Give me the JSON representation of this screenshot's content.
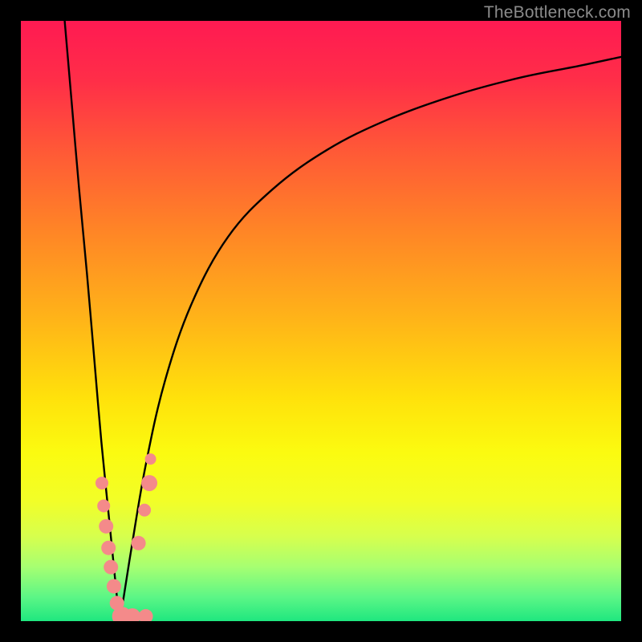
{
  "watermark": "TheBottleneck.com",
  "gradient_stops": [
    {
      "offset": 0.0,
      "color": "#ff1a52"
    },
    {
      "offset": 0.1,
      "color": "#ff2e48"
    },
    {
      "offset": 0.22,
      "color": "#ff5a36"
    },
    {
      "offset": 0.35,
      "color": "#ff8526"
    },
    {
      "offset": 0.5,
      "color": "#ffb518"
    },
    {
      "offset": 0.63,
      "color": "#ffe20b"
    },
    {
      "offset": 0.72,
      "color": "#fbfb10"
    },
    {
      "offset": 0.8,
      "color": "#f2fe28"
    },
    {
      "offset": 0.86,
      "color": "#d6ff4e"
    },
    {
      "offset": 0.91,
      "color": "#a6ff72"
    },
    {
      "offset": 0.96,
      "color": "#5cf686"
    },
    {
      "offset": 1.0,
      "color": "#1fe77f"
    }
  ],
  "chart_data": {
    "type": "line",
    "title": "",
    "xlabel": "",
    "ylabel": "",
    "xlim": [
      0,
      1
    ],
    "ylim": [
      0,
      1
    ],
    "note": "x and y are normalized to [0,1]; y is drawn from top (0) to bottom (1). The minimum of both curves occurs near x≈0.165, y≈1.0.",
    "series": [
      {
        "name": "left-curve",
        "x": [
          0.073,
          0.085,
          0.097,
          0.11,
          0.122,
          0.134,
          0.147,
          0.159,
          0.165
        ],
        "y": [
          0.0,
          0.14,
          0.28,
          0.42,
          0.56,
          0.7,
          0.83,
          0.95,
          1.0
        ]
      },
      {
        "name": "right-curve",
        "x": [
          0.165,
          0.184,
          0.208,
          0.24,
          0.285,
          0.345,
          0.42,
          0.51,
          0.61,
          0.72,
          0.83,
          0.93,
          1.0
        ],
        "y": [
          1.0,
          0.88,
          0.74,
          0.6,
          0.47,
          0.36,
          0.28,
          0.215,
          0.165,
          0.125,
          0.095,
          0.075,
          0.06
        ]
      }
    ],
    "markers": {
      "name": "pink-markers",
      "color": "#f48a8a",
      "points": [
        {
          "x": 0.135,
          "y": 0.77,
          "r": 8
        },
        {
          "x": 0.138,
          "y": 0.808,
          "r": 8
        },
        {
          "x": 0.142,
          "y": 0.842,
          "r": 9
        },
        {
          "x": 0.146,
          "y": 0.878,
          "r": 9
        },
        {
          "x": 0.15,
          "y": 0.91,
          "r": 9
        },
        {
          "x": 0.155,
          "y": 0.942,
          "r": 9
        },
        {
          "x": 0.16,
          "y": 0.97,
          "r": 9
        },
        {
          "x": 0.168,
          "y": 0.992,
          "r": 12
        },
        {
          "x": 0.186,
          "y": 0.992,
          "r": 10
        },
        {
          "x": 0.208,
          "y": 0.992,
          "r": 9
        },
        {
          "x": 0.196,
          "y": 0.87,
          "r": 9
        },
        {
          "x": 0.206,
          "y": 0.815,
          "r": 8
        },
        {
          "x": 0.214,
          "y": 0.77,
          "r": 10
        },
        {
          "x": 0.216,
          "y": 0.73,
          "r": 7
        }
      ]
    }
  }
}
